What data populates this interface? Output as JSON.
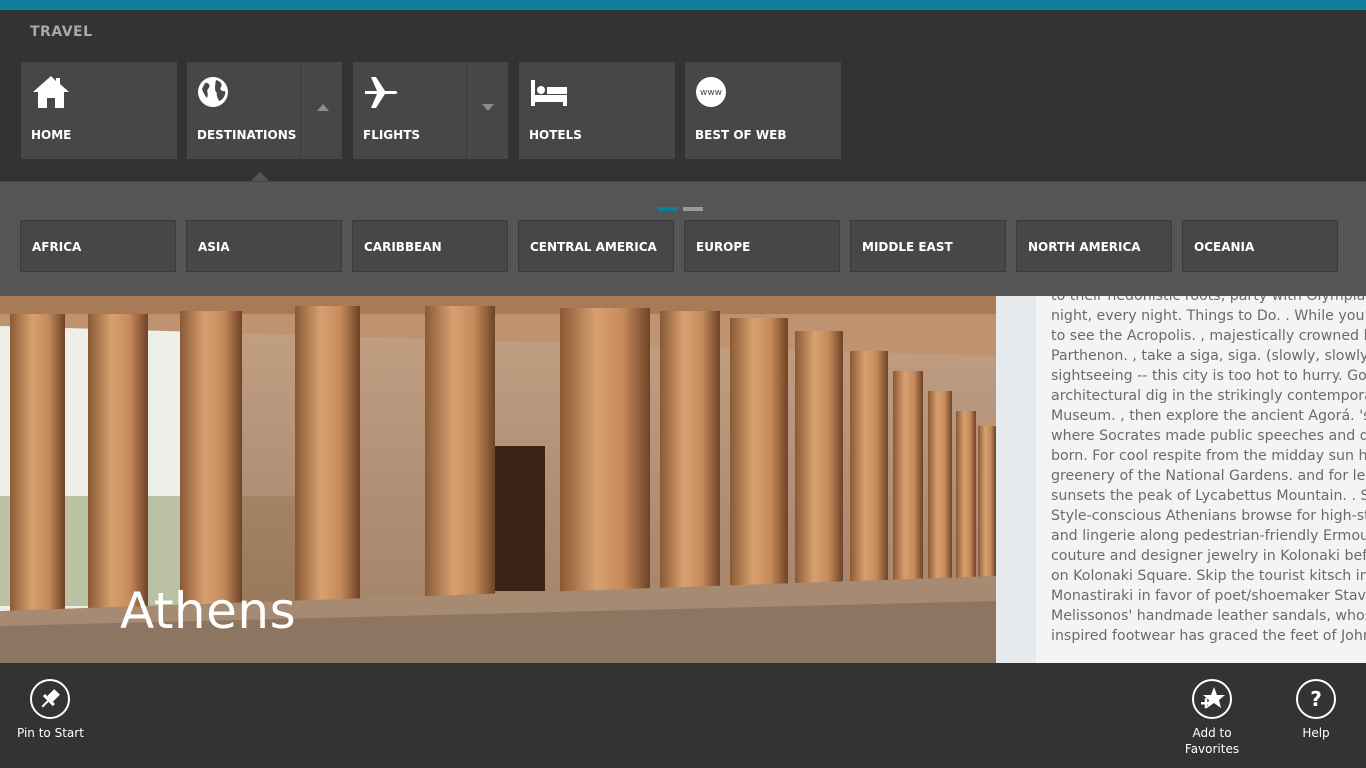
{
  "app": {
    "title": "TRAVEL"
  },
  "nav": {
    "tiles": [
      {
        "label": "HOME",
        "icon": "home-icon"
      },
      {
        "label": "DESTINATIONS",
        "icon": "globe-icon"
      },
      {
        "label": "FLIGHTS",
        "icon": "airplane-icon"
      },
      {
        "label": "HOTELS",
        "icon": "bed-icon"
      },
      {
        "label": "BEST OF WEB",
        "icon": "www-icon"
      }
    ]
  },
  "destinations_menu": {
    "pager": {
      "pages": 2,
      "active_page": 1,
      "active_color": "#0f7e9b",
      "inactive_color": "#9a9a9a"
    },
    "regions": [
      "AFRICA",
      "ASIA",
      "CARIBBEAN",
      "CENTRAL AMERICA",
      "EUROPE",
      "MIDDLE EAST",
      "NORTH AMERICA",
      "OCEANIA"
    ]
  },
  "hero": {
    "city": "Athens"
  },
  "article": {
    "lines": [
      "to their hedonistic roots, party with Olympian stamina",
      "night, every night. Things to Do. . While you'll be",
      "to see the Acropolis. , majestically crowned by the",
      "Parthenon. , take a siga, siga. (slowly, slowly) appr",
      "sightseeing -- this city is too hot to hurry. Go on an",
      "architectural dig in the strikingly contemporary Acr",
      "Museum. , then explore the ancient Agorá. 's market",
      "where Socrates made public speeches and democra",
      "born. For cool respite from the midday sun head to",
      "greenery of the National Gardens. and for legendary",
      "sunsets the peak of Lycabettus Mountain. . Shop. .",
      "Style-conscious Athenians browse for high-street",
      "and lingerie along pedestrian-friendly Ermou and",
      "couture and designer jewelry in Kolonaki before",
      "on Kolonaki Square. Skip the tourist kitsch in Plaka",
      "Monastiraki in favor of poet/shoemaker Stavros",
      "Melissonos' handmade leather sandals, whose myth",
      "inspired footwear has graced the feet of John Lennon"
    ]
  },
  "appbar": {
    "pin_label": "Pin to Start",
    "favorites_label_1": "Add to",
    "favorites_label_2": "Favorites",
    "help_label": "Help",
    "help_glyph": "?"
  },
  "colors": {
    "accent": "#0f7e9b",
    "nav_bg": "#333333",
    "tile_bg": "#474747",
    "menu_bg": "#555555"
  }
}
